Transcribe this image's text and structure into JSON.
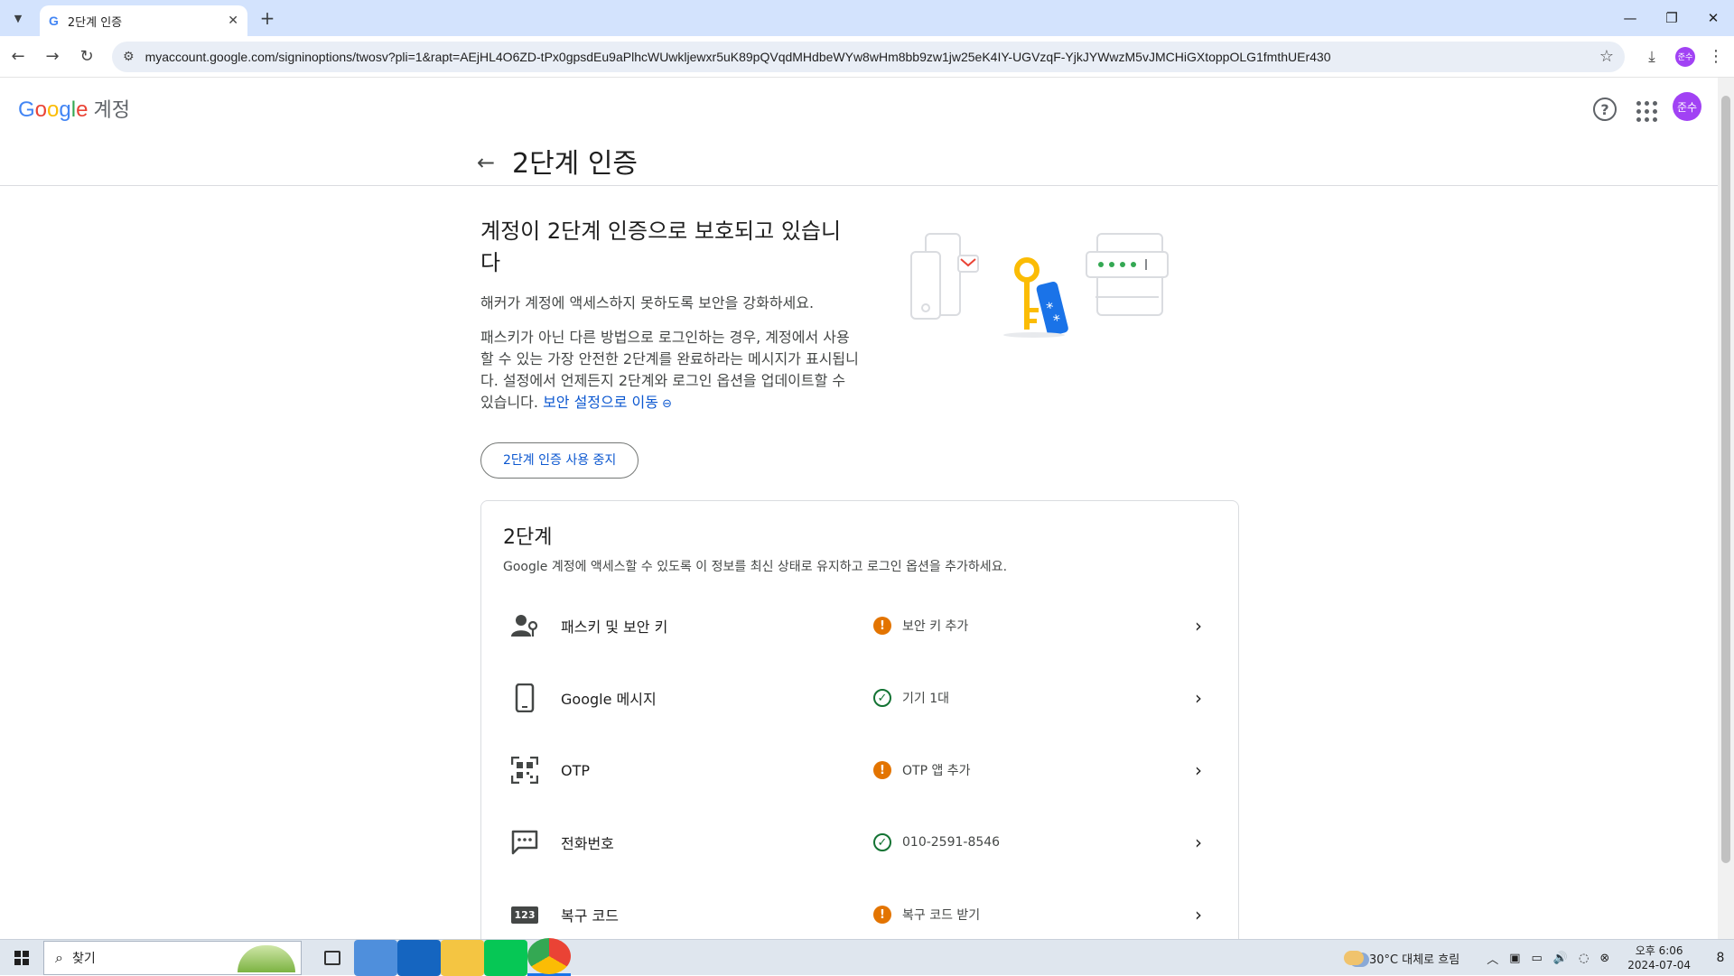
{
  "browser": {
    "tab_title": "2단계 인증",
    "favicon": "G",
    "tab_close": "✕",
    "new_tab": "+",
    "url": "myaccount.google.com/signinoptions/twosv?pli=1&rapt=AEjHL4O6ZD-tPx0gpsdEu9aPlhcWUwkljewxr5uK89pQVqdMHdbeWYw8wHm8bb9zw1jw25eK4IY-UGVzqF-YjkJYWwzM5vJMCHiGXtoppOLG1fmthUEr430",
    "profile_initials": "준수"
  },
  "header": {
    "logo_letters": [
      "G",
      "o",
      "o",
      "g",
      "l",
      "e"
    ],
    "product": "계정",
    "avatar_initials": "준수",
    "page_title": "2단계 인증"
  },
  "hero": {
    "title": "계정이 2단계 인증으로 보호되고 있습니다",
    "subtitle": "해커가 계정에 액세스하지 못하도록 보안을 강화하세요.",
    "body": "패스키가 아닌 다른 방법으로 로그인하는 경우, 계정에서 사용할 수 있는 가장 안전한 2단계를 완료하라는 메시지가 표시됩니다. 설정에서 언제든지 2단계와 로그인 옵션을 업데이트할 수 있습니다.",
    "link": "보안 설정으로 이동",
    "stop_button": "2단계 인증 사용 중지"
  },
  "card": {
    "title": "2단계",
    "description": "Google 계정에 액세스할 수 있도록 이 정보를 최신 상태로 유지하고 로그인 옵션을 추가하세요.",
    "rows": [
      {
        "label": "패스키 및 보안 키",
        "status": "보안 키 추가",
        "status_type": "warn",
        "icon": "passkey-icon"
      },
      {
        "label": "Google 메시지",
        "status": "기기 1대",
        "status_type": "ok",
        "icon": "phone-icon"
      },
      {
        "label": "OTP",
        "status": "OTP 앱 추가",
        "status_type": "warn",
        "icon": "qr-code-icon"
      },
      {
        "label": "전화번호",
        "status": "010-2591-8546",
        "status_type": "ok",
        "icon": "sms-icon"
      },
      {
        "label": "복구 코드",
        "status": "복구 코드 받기",
        "status_type": "warn",
        "icon": "recovery-code-icon",
        "icon_text": "123"
      }
    ]
  },
  "taskbar": {
    "search_placeholder": "찾기",
    "weather": "30°C  대체로 흐림",
    "clock_time": "오후 6:06",
    "clock_date": "2024-07-04",
    "notification_count": "8"
  },
  "colors": {
    "accent": "#0b57d0",
    "warn": "#e37400",
    "ok": "#137333",
    "avatar": "#a142f4"
  }
}
